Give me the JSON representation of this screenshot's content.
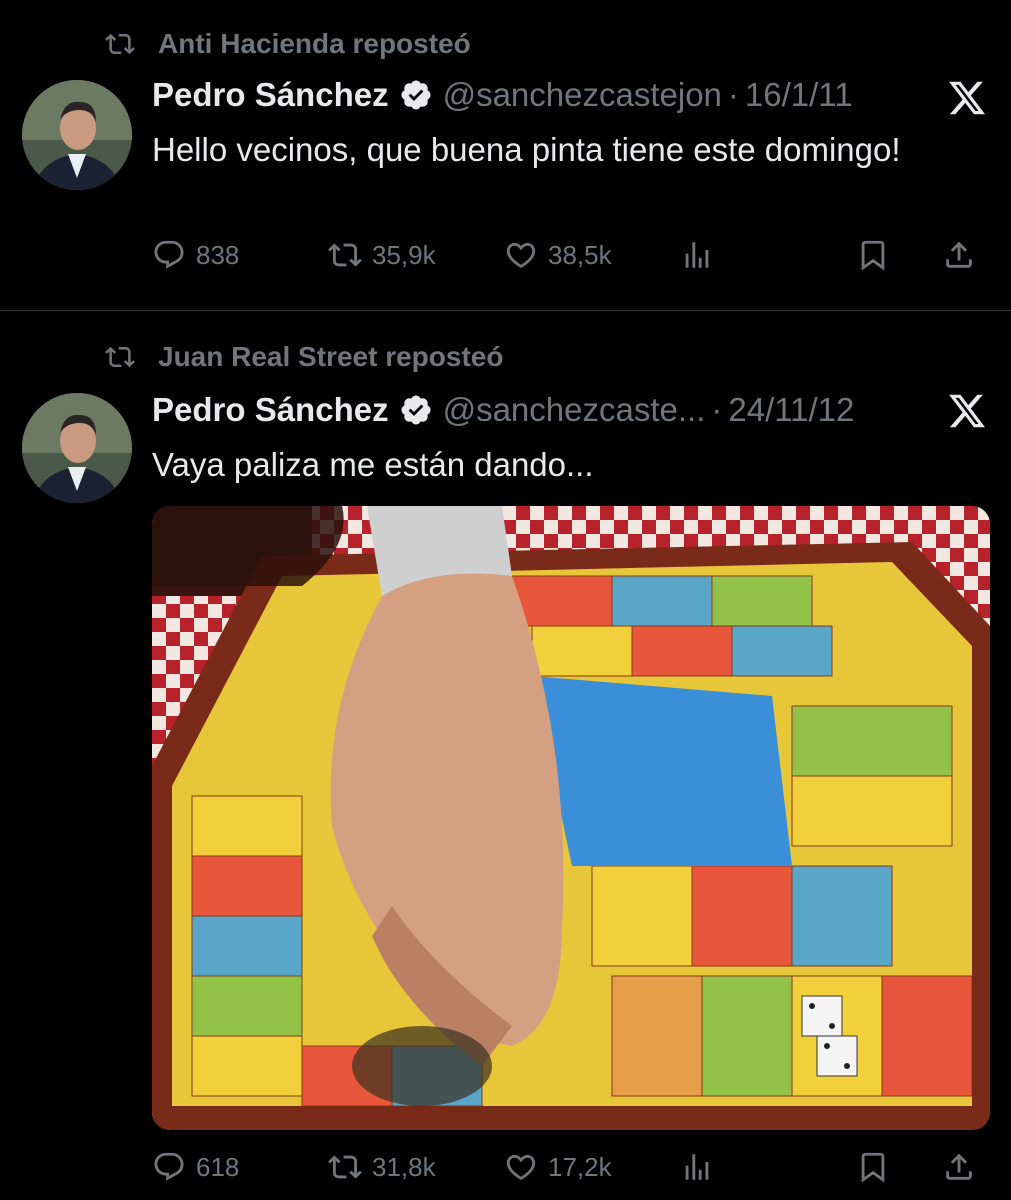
{
  "tweets": [
    {
      "reposted_by": "Anti Hacienda reposteó",
      "author_name": "Pedro Sánchez",
      "handle": "@sanchezcastejon",
      "dot": "·",
      "date": "16/1/11",
      "text": "Hello vecinos, que buena pinta tiene este domingo!",
      "replies": "838",
      "reposts": "35,9k",
      "likes": "38,5k"
    },
    {
      "reposted_by": "Juan Real Street reposteó",
      "author_name": "Pedro Sánchez",
      "handle": "@sanchezcaste...",
      "dot": "·",
      "date": "24/11/12",
      "text": "Vaya paliza me están dando...",
      "replies": "618",
      "reposts": "31,8k",
      "likes": "17,2k"
    }
  ],
  "colors": {
    "background": "#000000",
    "text": "#e7e9ea",
    "muted": "#71767b",
    "verified": "#e7e9ea"
  },
  "icons": [
    "repost-icon",
    "verified-badge-icon",
    "x-logo-icon",
    "reply-icon",
    "like-icon",
    "views-icon",
    "bookmark-icon",
    "share-icon"
  ]
}
